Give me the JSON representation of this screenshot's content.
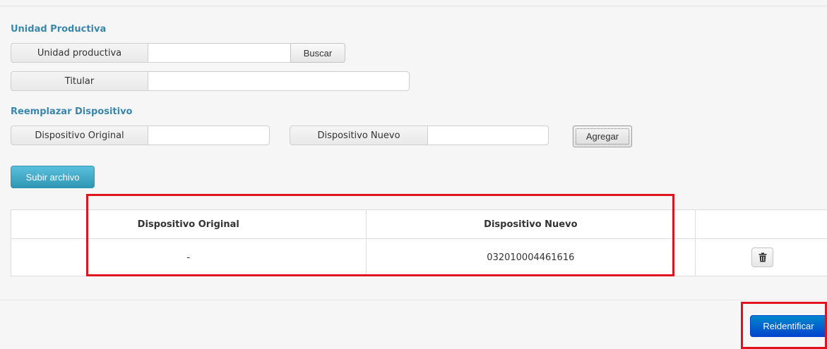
{
  "unidad_section": {
    "title": "Unidad Productiva",
    "unidad_label": "Unidad productiva",
    "unidad_value": "",
    "buscar_label": "Buscar",
    "titular_label": "Titular",
    "titular_value": ""
  },
  "reemplazar_section": {
    "title": "Reemplazar Dispositivo",
    "original_label": "Dispositivo Original",
    "original_value": "",
    "nuevo_label": "Dispositivo Nuevo",
    "nuevo_value": "",
    "agregar_label": "Agregar"
  },
  "upload": {
    "label": "Subir archivo"
  },
  "table": {
    "headers": [
      "Dispositivo Original",
      "Dispositivo Nuevo",
      ""
    ],
    "rows": [
      {
        "original": "-",
        "nuevo": "032010004461616",
        "action_icon": "trash-icon"
      }
    ]
  },
  "footer": {
    "reidentificar_label": "Reidentificar"
  },
  "colors": {
    "section_title": "#3a87ad",
    "primary_button": "#0044cc",
    "info_button": "#2f96b4",
    "highlight": "#e0141e"
  }
}
